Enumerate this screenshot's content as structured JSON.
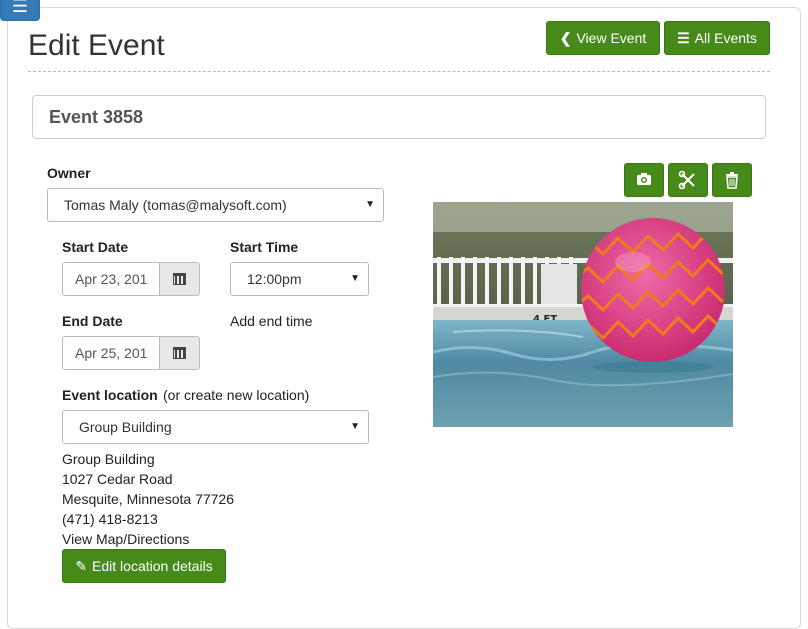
{
  "page": {
    "title": "Edit Event"
  },
  "header_buttons": {
    "view_event": "View Event",
    "all_events": "All Events"
  },
  "event": {
    "name": "Event 3858"
  },
  "owner": {
    "label": "Owner",
    "value": "Tomas Maly (tomas@malysoft.com)"
  },
  "start_date": {
    "label": "Start Date",
    "value": "Apr 23, 201"
  },
  "start_time": {
    "label": "Start Time",
    "value": "12:00pm"
  },
  "end_date": {
    "label": "End Date",
    "value": "Apr 25, 201"
  },
  "add_end_time": "Add end time",
  "location": {
    "label": "Event location",
    "create_link": "(or create new location)",
    "selected": "Group Building",
    "name": "Group Building",
    "street": "1027 Cedar Road",
    "city_line": "Mesquite, Minnesota 77726",
    "phone": "(471) 418-8213",
    "map_link": "View Map/Directions",
    "edit_button": "Edit location details"
  },
  "image_tools": {
    "icons": [
      "camera-icon",
      "crop-icon",
      "trash-icon"
    ]
  },
  "colors": {
    "accent_green": "#468a1a",
    "menu_blue": "#337ab7"
  }
}
